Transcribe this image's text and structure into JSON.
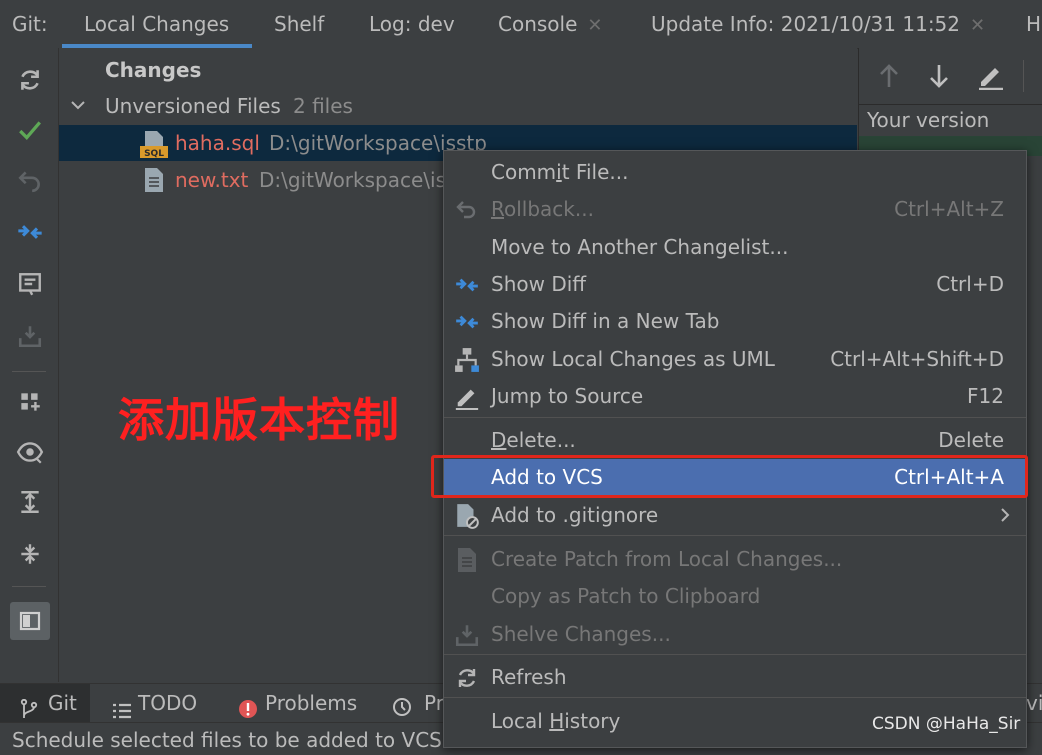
{
  "tabs": {
    "prefix": "Git:",
    "items": [
      {
        "label": "Local Changes",
        "active": true
      },
      {
        "label": "Shelf"
      },
      {
        "label": "Log: dev"
      },
      {
        "label": "Console",
        "closable": true
      },
      {
        "label": "Update Info: 2021/10/31 11:52",
        "closable": true
      },
      {
        "label": "H"
      }
    ]
  },
  "tree": {
    "root": "Changes",
    "group": {
      "label": "Unversioned Files",
      "count": "2 files"
    },
    "files": [
      {
        "name": "haha.sql",
        "path": "D:\\gitWorkspace\\isstp"
      },
      {
        "name": "new.txt",
        "path": "D:\\gitWorkspace\\is"
      }
    ]
  },
  "right_panel": {
    "title": "Your version"
  },
  "annotation": "添加版本控制",
  "context_menu": {
    "items": [
      {
        "label_pre": "Comm",
        "mnemonic": "i",
        "label_post": "t File...",
        "shortcut": ""
      },
      {
        "label_pre": "",
        "mnemonic": "R",
        "label_post": "ollback...",
        "shortcut": "Ctrl+Alt+Z"
      },
      {
        "label_pre": "Move to Another Changelist...",
        "mnemonic": "",
        "label_post": "",
        "shortcut": ""
      },
      {
        "label_pre": "Show Diff",
        "mnemonic": "",
        "label_post": "",
        "shortcut": "Ctrl+D"
      },
      {
        "label_pre": "Show Diff in a New Tab",
        "mnemonic": "",
        "label_post": "",
        "shortcut": ""
      },
      {
        "label_pre": "Show Local Changes as UML",
        "mnemonic": "",
        "label_post": "",
        "shortcut": "Ctrl+Alt+Shift+D"
      },
      {
        "label_pre": "Jump to Source",
        "mnemonic": "",
        "label_post": "",
        "shortcut": "F12"
      },
      {
        "label_pre": "",
        "mnemonic": "D",
        "label_post": "elete...",
        "shortcut": "Delete"
      },
      {
        "label_pre": "Add to VCS",
        "mnemonic": "",
        "label_post": "",
        "shortcut": "Ctrl+Alt+A"
      },
      {
        "label_pre": "Add to .gitignore",
        "mnemonic": "",
        "label_post": "",
        "shortcut": ""
      },
      {
        "label_pre": "Create Patch from Local Changes...",
        "mnemonic": "",
        "label_post": "",
        "shortcut": ""
      },
      {
        "label_pre": "Copy as Patch to Clipboard",
        "mnemonic": "",
        "label_post": "",
        "shortcut": ""
      },
      {
        "label_pre": "Shelve Changes...",
        "mnemonic": "",
        "label_post": "",
        "shortcut": ""
      },
      {
        "label_pre": "Refresh",
        "mnemonic": "",
        "label_post": "",
        "shortcut": ""
      },
      {
        "label_pre": "Local ",
        "mnemonic": "H",
        "label_post": "istory",
        "shortcut": ""
      }
    ]
  },
  "bottom_tabs": [
    {
      "label": "Git"
    },
    {
      "label": "TODO"
    },
    {
      "label": "Problems"
    },
    {
      "label": "Pr"
    }
  ],
  "bottom_right_fragment": "vi",
  "status": "Schedule selected files to be added to VCS",
  "watermark": "CSDN @HaHa_Sir",
  "colors": {
    "accent": "#4a88c7",
    "highlight": "#4b6eaf",
    "annotation": "#ff2020",
    "unversioned": "#e06c60"
  }
}
